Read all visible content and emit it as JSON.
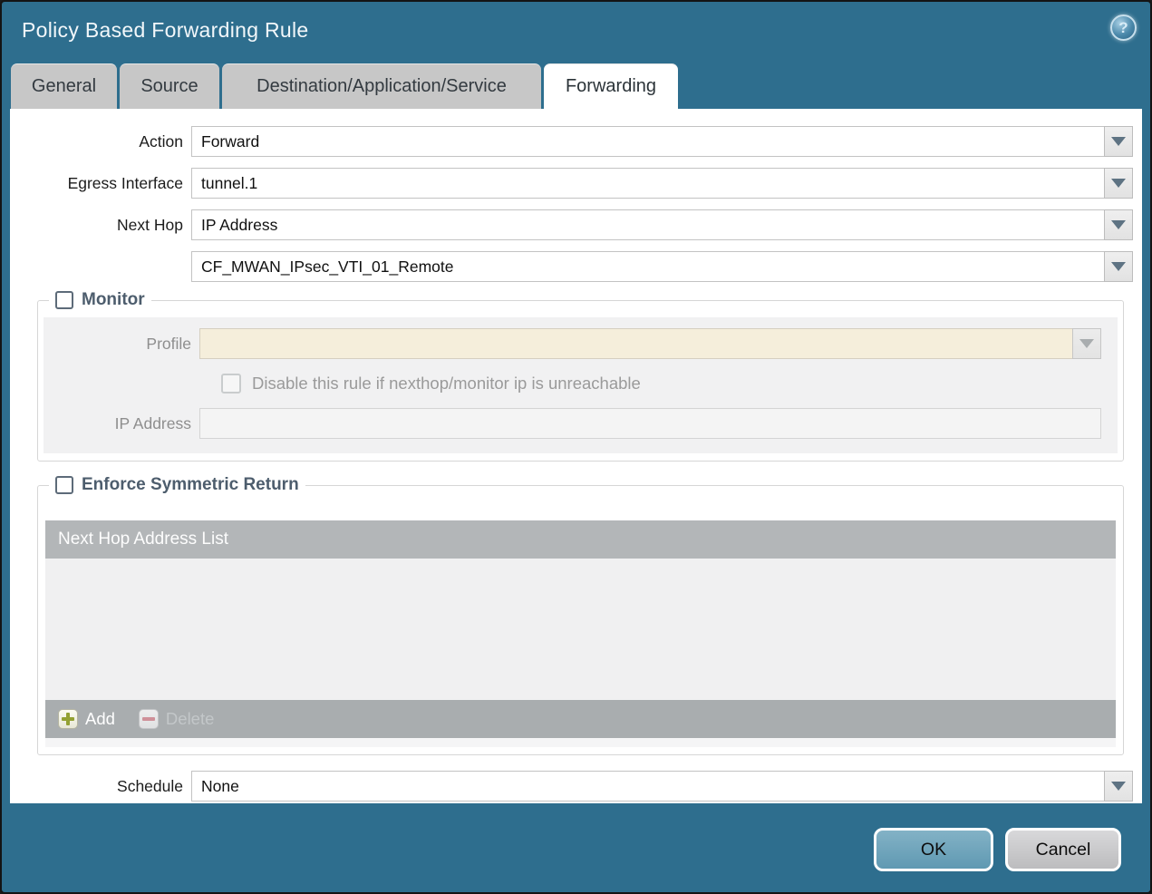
{
  "window": {
    "title": "Policy Based Forwarding Rule"
  },
  "icons": {
    "help": "?"
  },
  "tabs": [
    {
      "label": "General"
    },
    {
      "label": "Source"
    },
    {
      "label": "Destination/Application/Service"
    },
    {
      "label": "Forwarding"
    }
  ],
  "form": {
    "action": {
      "label": "Action",
      "value": "Forward"
    },
    "egress_interface": {
      "label": "Egress Interface",
      "value": "tunnel.1"
    },
    "next_hop": {
      "label": "Next Hop",
      "value": "IP Address"
    },
    "next_hop_address": {
      "value": "CF_MWAN_IPsec_VTI_01_Remote"
    },
    "schedule": {
      "label": "Schedule",
      "value": "None"
    }
  },
  "monitor": {
    "legend": "Monitor",
    "checked": false,
    "profile": {
      "label": "Profile",
      "value": ""
    },
    "disable_rule_checkbox": {
      "label": "Disable this rule if nexthop/monitor ip is unreachable",
      "checked": false
    },
    "ip_address": {
      "label": "IP Address",
      "value": ""
    }
  },
  "enforce_symmetric_return": {
    "legend": "Enforce Symmetric Return",
    "checked": false,
    "next_hop_list": {
      "header": "Next Hop Address List",
      "rows": [],
      "add_label": "Add",
      "delete_label": "Delete"
    }
  },
  "footer": {
    "ok_label": "OK",
    "cancel_label": "Cancel"
  },
  "colors": {
    "titlebar": "#2e6e8e",
    "active_tab": "#ffffff",
    "inactive_tab": "#c7c7c7",
    "legend_text": "#4d5d6d",
    "disabled_field": "#f5eedb",
    "table_header": "#b3b6b8",
    "table_footer": "#a9adaf",
    "ok_button": "#6ba3bb",
    "cancel_button": "#cbcbcd"
  }
}
